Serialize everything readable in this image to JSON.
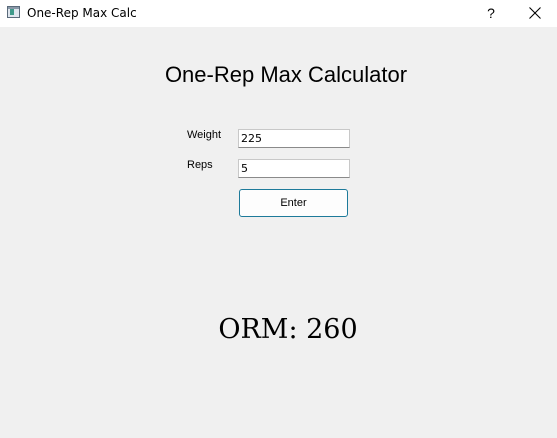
{
  "window": {
    "title": "One-Rep Max Calc",
    "help_label": "?",
    "close_icon": "close-icon",
    "app_icon": "app-window-icon"
  },
  "main": {
    "heading": "One-Rep Max Calculator",
    "weight_label": "Weight",
    "weight_value": "225",
    "reps_label": "Reps",
    "reps_value": "5",
    "enter_label": "Enter",
    "result_text": "ORM: 260"
  }
}
